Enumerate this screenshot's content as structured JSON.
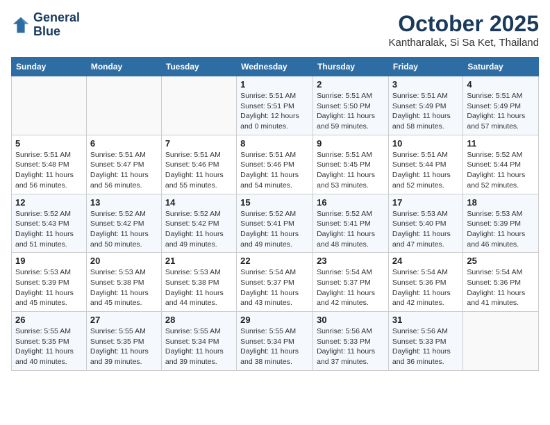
{
  "header": {
    "logo_line1": "General",
    "logo_line2": "Blue",
    "month_title": "October 2025",
    "location": "Kantharalak, Si Sa Ket, Thailand"
  },
  "days_of_week": [
    "Sunday",
    "Monday",
    "Tuesday",
    "Wednesday",
    "Thursday",
    "Friday",
    "Saturday"
  ],
  "weeks": [
    [
      {
        "day": "",
        "sunrise": "",
        "sunset": "",
        "daylight": ""
      },
      {
        "day": "",
        "sunrise": "",
        "sunset": "",
        "daylight": ""
      },
      {
        "day": "",
        "sunrise": "",
        "sunset": "",
        "daylight": ""
      },
      {
        "day": "1",
        "sunrise": "Sunrise: 5:51 AM",
        "sunset": "Sunset: 5:51 PM",
        "daylight": "Daylight: 12 hours and 0 minutes."
      },
      {
        "day": "2",
        "sunrise": "Sunrise: 5:51 AM",
        "sunset": "Sunset: 5:50 PM",
        "daylight": "Daylight: 11 hours and 59 minutes."
      },
      {
        "day": "3",
        "sunrise": "Sunrise: 5:51 AM",
        "sunset": "Sunset: 5:49 PM",
        "daylight": "Daylight: 11 hours and 58 minutes."
      },
      {
        "day": "4",
        "sunrise": "Sunrise: 5:51 AM",
        "sunset": "Sunset: 5:49 PM",
        "daylight": "Daylight: 11 hours and 57 minutes."
      }
    ],
    [
      {
        "day": "5",
        "sunrise": "Sunrise: 5:51 AM",
        "sunset": "Sunset: 5:48 PM",
        "daylight": "Daylight: 11 hours and 56 minutes."
      },
      {
        "day": "6",
        "sunrise": "Sunrise: 5:51 AM",
        "sunset": "Sunset: 5:47 PM",
        "daylight": "Daylight: 11 hours and 56 minutes."
      },
      {
        "day": "7",
        "sunrise": "Sunrise: 5:51 AM",
        "sunset": "Sunset: 5:46 PM",
        "daylight": "Daylight: 11 hours and 55 minutes."
      },
      {
        "day": "8",
        "sunrise": "Sunrise: 5:51 AM",
        "sunset": "Sunset: 5:46 PM",
        "daylight": "Daylight: 11 hours and 54 minutes."
      },
      {
        "day": "9",
        "sunrise": "Sunrise: 5:51 AM",
        "sunset": "Sunset: 5:45 PM",
        "daylight": "Daylight: 11 hours and 53 minutes."
      },
      {
        "day": "10",
        "sunrise": "Sunrise: 5:51 AM",
        "sunset": "Sunset: 5:44 PM",
        "daylight": "Daylight: 11 hours and 52 minutes."
      },
      {
        "day": "11",
        "sunrise": "Sunrise: 5:52 AM",
        "sunset": "Sunset: 5:44 PM",
        "daylight": "Daylight: 11 hours and 52 minutes."
      }
    ],
    [
      {
        "day": "12",
        "sunrise": "Sunrise: 5:52 AM",
        "sunset": "Sunset: 5:43 PM",
        "daylight": "Daylight: 11 hours and 51 minutes."
      },
      {
        "day": "13",
        "sunrise": "Sunrise: 5:52 AM",
        "sunset": "Sunset: 5:42 PM",
        "daylight": "Daylight: 11 hours and 50 minutes."
      },
      {
        "day": "14",
        "sunrise": "Sunrise: 5:52 AM",
        "sunset": "Sunset: 5:42 PM",
        "daylight": "Daylight: 11 hours and 49 minutes."
      },
      {
        "day": "15",
        "sunrise": "Sunrise: 5:52 AM",
        "sunset": "Sunset: 5:41 PM",
        "daylight": "Daylight: 11 hours and 49 minutes."
      },
      {
        "day": "16",
        "sunrise": "Sunrise: 5:52 AM",
        "sunset": "Sunset: 5:41 PM",
        "daylight": "Daylight: 11 hours and 48 minutes."
      },
      {
        "day": "17",
        "sunrise": "Sunrise: 5:53 AM",
        "sunset": "Sunset: 5:40 PM",
        "daylight": "Daylight: 11 hours and 47 minutes."
      },
      {
        "day": "18",
        "sunrise": "Sunrise: 5:53 AM",
        "sunset": "Sunset: 5:39 PM",
        "daylight": "Daylight: 11 hours and 46 minutes."
      }
    ],
    [
      {
        "day": "19",
        "sunrise": "Sunrise: 5:53 AM",
        "sunset": "Sunset: 5:39 PM",
        "daylight": "Daylight: 11 hours and 45 minutes."
      },
      {
        "day": "20",
        "sunrise": "Sunrise: 5:53 AM",
        "sunset": "Sunset: 5:38 PM",
        "daylight": "Daylight: 11 hours and 45 minutes."
      },
      {
        "day": "21",
        "sunrise": "Sunrise: 5:53 AM",
        "sunset": "Sunset: 5:38 PM",
        "daylight": "Daylight: 11 hours and 44 minutes."
      },
      {
        "day": "22",
        "sunrise": "Sunrise: 5:54 AM",
        "sunset": "Sunset: 5:37 PM",
        "daylight": "Daylight: 11 hours and 43 minutes."
      },
      {
        "day": "23",
        "sunrise": "Sunrise: 5:54 AM",
        "sunset": "Sunset: 5:37 PM",
        "daylight": "Daylight: 11 hours and 42 minutes."
      },
      {
        "day": "24",
        "sunrise": "Sunrise: 5:54 AM",
        "sunset": "Sunset: 5:36 PM",
        "daylight": "Daylight: 11 hours and 42 minutes."
      },
      {
        "day": "25",
        "sunrise": "Sunrise: 5:54 AM",
        "sunset": "Sunset: 5:36 PM",
        "daylight": "Daylight: 11 hours and 41 minutes."
      }
    ],
    [
      {
        "day": "26",
        "sunrise": "Sunrise: 5:55 AM",
        "sunset": "Sunset: 5:35 PM",
        "daylight": "Daylight: 11 hours and 40 minutes."
      },
      {
        "day": "27",
        "sunrise": "Sunrise: 5:55 AM",
        "sunset": "Sunset: 5:35 PM",
        "daylight": "Daylight: 11 hours and 39 minutes."
      },
      {
        "day": "28",
        "sunrise": "Sunrise: 5:55 AM",
        "sunset": "Sunset: 5:34 PM",
        "daylight": "Daylight: 11 hours and 39 minutes."
      },
      {
        "day": "29",
        "sunrise": "Sunrise: 5:55 AM",
        "sunset": "Sunset: 5:34 PM",
        "daylight": "Daylight: 11 hours and 38 minutes."
      },
      {
        "day": "30",
        "sunrise": "Sunrise: 5:56 AM",
        "sunset": "Sunset: 5:33 PM",
        "daylight": "Daylight: 11 hours and 37 minutes."
      },
      {
        "day": "31",
        "sunrise": "Sunrise: 5:56 AM",
        "sunset": "Sunset: 5:33 PM",
        "daylight": "Daylight: 11 hours and 36 minutes."
      },
      {
        "day": "",
        "sunrise": "",
        "sunset": "",
        "daylight": ""
      }
    ]
  ]
}
